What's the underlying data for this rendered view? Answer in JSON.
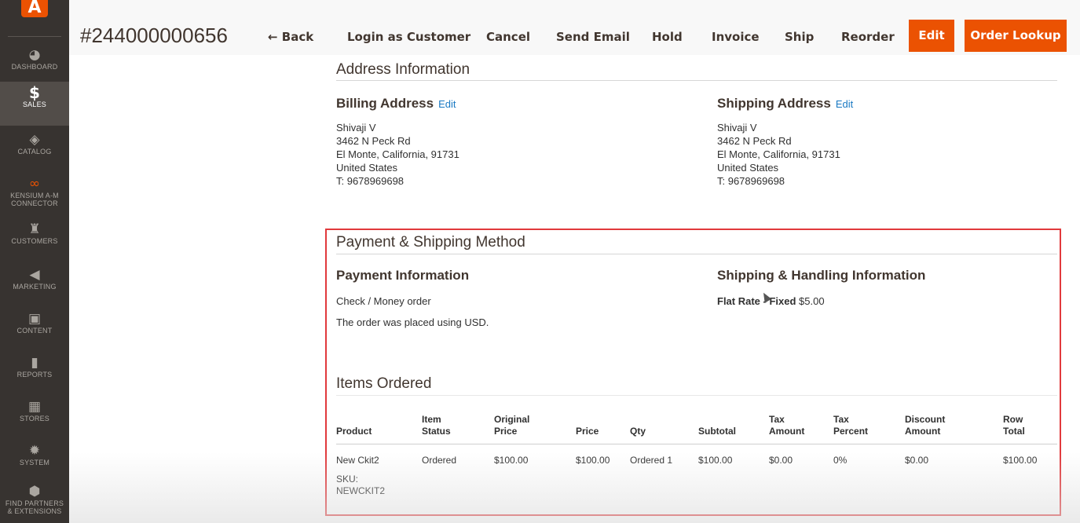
{
  "sidebar": {
    "logo_glyph": "A",
    "items": [
      {
        "label": "Dashboard",
        "icon": "speedometer-icon",
        "glyph": "◕"
      },
      {
        "label": "Sales",
        "icon": "dollar-icon",
        "glyph": "$"
      },
      {
        "label": "Catalog",
        "icon": "box-icon",
        "glyph": "◈"
      },
      {
        "label": "Kensium A-M Connector",
        "line1": "KENSIUM A-M",
        "line2": "CONNECTOR",
        "icon": "connector-icon",
        "glyph": "∞"
      },
      {
        "label": "Customers",
        "icon": "person-icon",
        "glyph": "♜"
      },
      {
        "label": "Marketing",
        "icon": "megaphone-icon",
        "glyph": "◀"
      },
      {
        "label": "Content",
        "icon": "layout-icon",
        "glyph": "▣"
      },
      {
        "label": "Reports",
        "icon": "bar-chart-icon",
        "glyph": "▮"
      },
      {
        "label": "Stores",
        "icon": "store-icon",
        "glyph": "▦"
      },
      {
        "label": "System",
        "icon": "gear-icon",
        "glyph": "✹"
      },
      {
        "label": "Find Partners & Extensions",
        "line1": "FIND PARTNERS",
        "line2": "& EXTENSIONS",
        "icon": "cube-icon",
        "glyph": "⬢"
      }
    ]
  },
  "header": {
    "order_number": "#244000000656",
    "back": "← Back",
    "login_as_customer": "Login as Customer",
    "cancel": "Cancel",
    "send_email": "Send Email",
    "hold": "Hold",
    "invoice": "Invoice",
    "ship": "Ship",
    "reorder": "Reorder",
    "edit": "Edit",
    "order_lookup": "Order Lookup"
  },
  "address": {
    "section_title": "Address Information",
    "billing": {
      "title": "Billing Address",
      "edit": "Edit",
      "lines": [
        "Shivaji V",
        "3462 N Peck Rd",
        "El Monte, California, 91731",
        "United States",
        "T: 9678969698"
      ]
    },
    "shipping": {
      "title": "Shipping Address",
      "edit": "Edit",
      "lines": [
        "Shivaji V",
        "3462 N Peck Rd",
        "El Monte, California, 91731",
        "United States",
        "T: 9678969698"
      ]
    }
  },
  "payment_shipping": {
    "section_title": "Payment & Shipping Method",
    "payment_title": "Payment Information",
    "payment_method": "Check / Money order",
    "currency_note": "The order was placed using USD.",
    "shipping_title": "Shipping & Handling Information",
    "shipping_method": "Flat Rate - Fixed",
    "shipping_price": "$5.00"
  },
  "items": {
    "section_title": "Items Ordered",
    "headers": [
      {
        "l1": "",
        "l2": "Product"
      },
      {
        "l1": "Item",
        "l2": "Status"
      },
      {
        "l1": "Original",
        "l2": "Price"
      },
      {
        "l1": "",
        "l2": "Price"
      },
      {
        "l1": "",
        "l2": "Qty"
      },
      {
        "l1": "",
        "l2": "Subtotal"
      },
      {
        "l1": "Tax",
        "l2": "Amount"
      },
      {
        "l1": "Tax",
        "l2": "Percent"
      },
      {
        "l1": "Discount",
        "l2": "Amount"
      },
      {
        "l1": "Row",
        "l2": "Total"
      }
    ],
    "rows": [
      {
        "product": "New Ckit2",
        "sku_label": "SKU:",
        "sku": "NEWCKIT2",
        "status": "Ordered",
        "original_price": "$100.00",
        "price": "$100.00",
        "qty": "Ordered 1",
        "subtotal": "$100.00",
        "tax_amount": "$0.00",
        "tax_percent": "0%",
        "discount": "$0.00",
        "row_total": "$100.00"
      }
    ]
  },
  "colors": {
    "sidebar_bg": "#373330",
    "sidebar_active": "#524d49",
    "accent": "#eb5202",
    "link": "#1979c3",
    "highlight": "#e1393c"
  }
}
